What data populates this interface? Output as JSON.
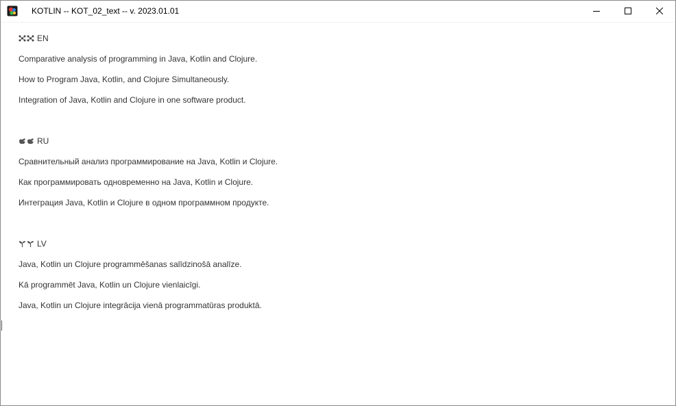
{
  "window": {
    "title": "KOTLIN -- KOT_02_text -- v. 2023.01.01",
    "icon": "app-icon",
    "controls": [
      "minimize-icon",
      "maximize-icon",
      "close-icon"
    ]
  },
  "sections": [
    {
      "code": "EN",
      "glyph": "molecule-icon",
      "lines": [
        "Comparative analysis of programming in Java, Kotlin and Clojure.",
        "How to Program Java, Kotlin, and Clojure Simultaneously.",
        "Integration of Java, Kotlin and Clojure in one software product."
      ]
    },
    {
      "code": "RU",
      "glyph": "hand-icon",
      "lines": [
        "Сравнительный анализ программирование на Java, Kotlin и Clojure.",
        "Как программировать одновременно на Java, Kotlin и Clojure.",
        "Интеграция Java, Kotlin и Clojure в одном программном продукте."
      ]
    },
    {
      "code": "LV",
      "glyph": "sprout-icon",
      "lines": [
        "Java, Kotlin un Clojure programmēšanas salīdzinošā analīze.",
        "Kā programmēt Java, Kotlin un Clojure vienlaicīgi.",
        "Java, Kotlin un Clojure integrācija vienā programmatūras produktā."
      ]
    }
  ]
}
